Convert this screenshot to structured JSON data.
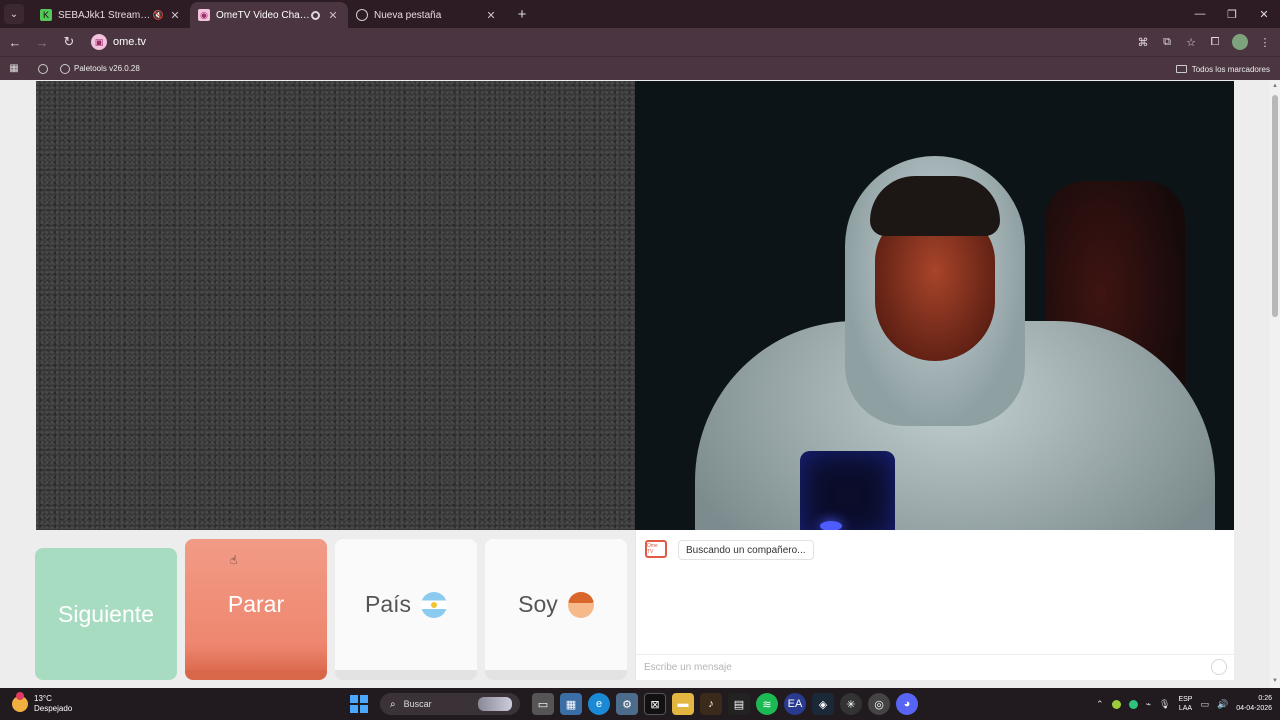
{
  "browser": {
    "tabs": [
      {
        "title": "SEBAJkk1 Stream - Watch Live",
        "active": false
      },
      {
        "title": "OmeTV Video Chat — Omegle Alternative",
        "active": true
      },
      {
        "title": "Nueva pestaña",
        "active": false
      }
    ],
    "url": "ome.tv",
    "bookmark_item": "Paletools v26.0.28",
    "bookmarks_all": "Todos los marcadores"
  },
  "controls": {
    "next_label": "Siguiente",
    "stop_label": "Parar",
    "country_label": "País",
    "soy_label": "Soy"
  },
  "chat": {
    "logo_text": "Ome TV",
    "status_message": "Buscando un compañero...",
    "input_placeholder": "Escribe un mensaje"
  },
  "taskbar": {
    "temperature": "13°C",
    "weather": "Despejado",
    "search_label": "Buscar",
    "lang_top": "ESP",
    "lang_bottom": "LAA",
    "time": "0:26",
    "date": "04-04-2026"
  },
  "colors": {
    "next_button": "#a8dcc1",
    "stop_button": "#ee876f",
    "browser_frame": "#4a3540"
  }
}
